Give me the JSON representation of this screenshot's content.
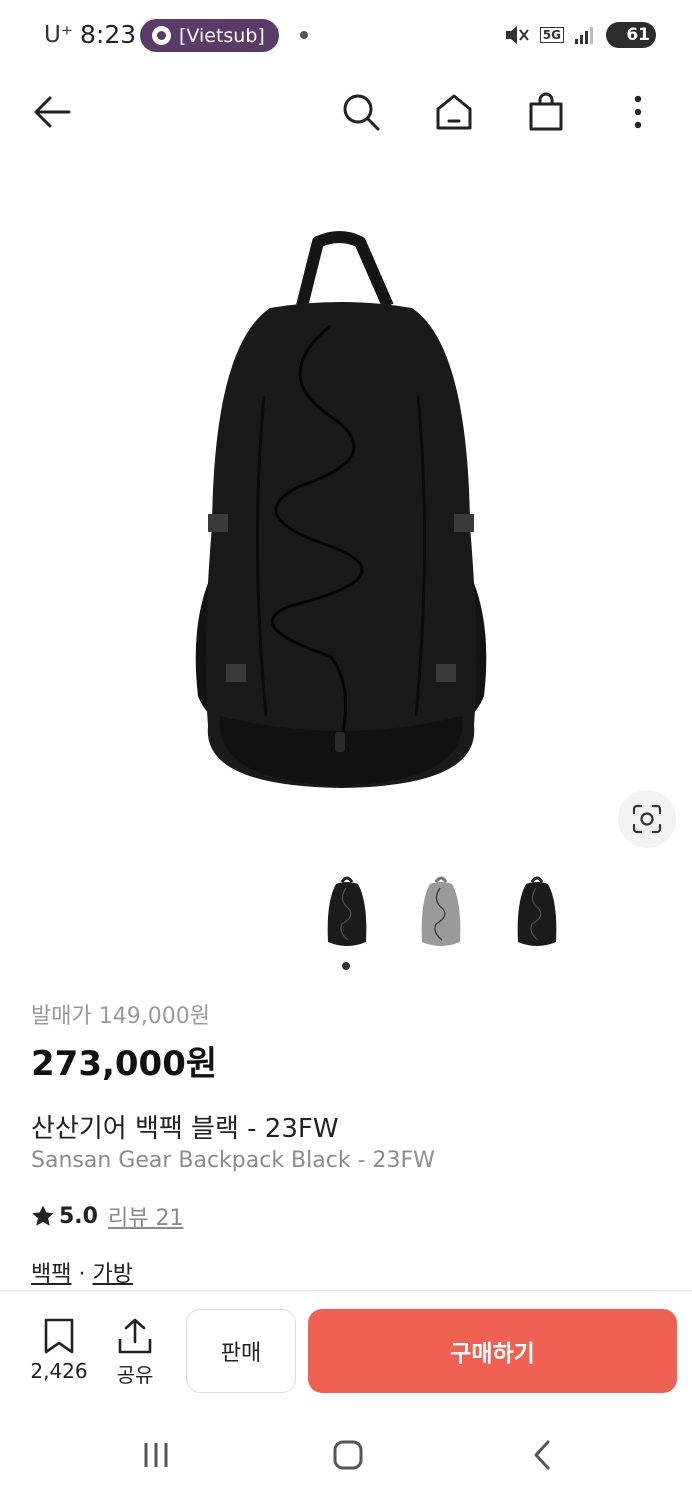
{
  "status_bar": {
    "carrier": "U⁺",
    "time": "8:23",
    "notification_pill": "[Vietsub]",
    "network": "5G",
    "battery": "61"
  },
  "app_bar": {
    "icons": [
      "back-arrow-icon",
      "search-icon",
      "home-icon",
      "shopping-bag-icon",
      "more-vertical-icon"
    ]
  },
  "product": {
    "release_price": "발매가 149,000원",
    "price": "273,000원",
    "name_ko": "산산기어 백팩 블랙 - 23FW",
    "name_en": "Sansan Gear Backpack Black - 23FW",
    "rating": "5.0",
    "reviews": "리뷰 21",
    "category_1": "백팩",
    "category_sep": "·",
    "category_2": "가방",
    "thumbnail_colors": [
      "#1b1b1b",
      "#9a9a9a",
      "#1b1b1b"
    ],
    "current_image_index": 1
  },
  "actions": {
    "bookmark_count": "2,426",
    "share_label": "공유",
    "sell_label": "판매",
    "buy_label": "구매하기",
    "buy_color": "#ef6253"
  }
}
